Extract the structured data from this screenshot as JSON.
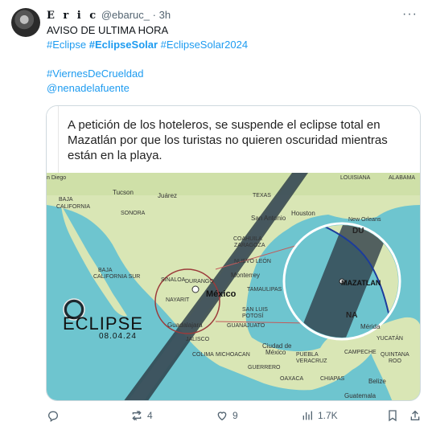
{
  "tweet": {
    "author_name": "E r i c",
    "handle": "@ebaruc_",
    "separator": "·",
    "time": "3h",
    "more_label": "···",
    "text_line1": "AVISO DE ULTIMA HORA",
    "hashtags_line1": [
      "#Eclipse",
      "#EclipseSolar",
      "#EclipseSolar2024"
    ],
    "hashtag_line2": "#ViernesDeCrueldad",
    "mention": "@nenadelafuente"
  },
  "card": {
    "quote_text": "A petición de los hoteleros, se suspende el eclipse total en Mazatlán por que los turistas no quieren oscuridad mientras están en la playa.",
    "map": {
      "logo_text": "ECLIPSE",
      "logo_date": "08.04.24",
      "zoom_label": "MAZATLAN",
      "labels": {
        "diego": "n Diego",
        "tucson": "Tucson",
        "juarez": "Juárez",
        "texas": "TEXAS",
        "louisiana": "LOUISIANA",
        "alabama": "ALABAMA",
        "baja": "BAJA",
        "california": "CALIFORNIA",
        "sonora": "SONORA",
        "san_antonio": "San Antonio",
        "houston": "Houston",
        "new_orleans": "New Orleans",
        "coahuila": "COAHUILA",
        "zaragoza": "ZARAGOZA",
        "nuevo_leon": "NUEVO LEÓN",
        "baja2": "BAJA",
        "california_sur": "CALIFORNIA SUR",
        "sinaloa": "SINALOA",
        "durango": "DURANGO",
        "monterrey": "Monterrey",
        "tamaulipas": "TAMAULIPAS",
        "mexico": "México",
        "san_luis": "SAN LUIS",
        "potosi": "POTOSÍ",
        "nayarit": "NAYARIT",
        "guadalajara": "Guadalajara",
        "guanajuato": "GUANAJUATO",
        "jalisco": "JALISCO",
        "colima": "COLIMA",
        "michoacan": "MICHOACAN",
        "ciudad": "Ciudad de",
        "mexico2": "México",
        "puebla": "PUEBLA",
        "veracruz": "VERACRUZ",
        "guerrero": "GUERRERO",
        "oaxaca": "OAXACA",
        "chiapas": "CHIAPAS",
        "merida": "Mérida",
        "yucatan": "YUCATÁN",
        "campeche": "CAMPECHE",
        "quintana": "QUINTANA",
        "roo": "ROO",
        "belize": "Belize",
        "guatemala": "Guatemala",
        "durango_short": "DU",
        "na_short": "NA"
      }
    }
  },
  "actions": {
    "reply_count": "",
    "retweet_count": "4",
    "like_count": "9",
    "views_count": "1.7K"
  },
  "colors": {
    "accent": "#1d9bf0",
    "muted": "#536471",
    "sea": "#6ec5cf",
    "land": "#d9e6b5"
  }
}
